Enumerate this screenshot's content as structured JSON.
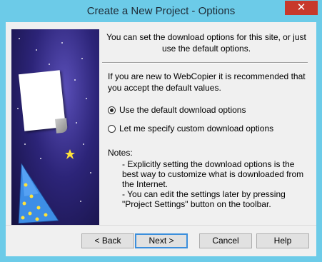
{
  "window": {
    "title": "Create a New Project - Options",
    "close_glyph": "✕"
  },
  "intro_text": "You can set the download options for this site, or just use the default options.",
  "recommend_text": "If you are new to WebCopier it is recommended that you accept the default values.",
  "options": [
    {
      "label": "Use the default download options",
      "selected": true
    },
    {
      "label": "Let me specify custom download options",
      "selected": false
    }
  ],
  "notes": {
    "label": "Notes:",
    "lines": [
      "- Explicitly setting the download options is the best way to customize what is downloaded from the Internet.",
      "- You can edit the settings later by pressing \"Project Settings\" button on the toolbar."
    ]
  },
  "buttons": {
    "back": "< Back",
    "next": "Next >",
    "cancel": "Cancel",
    "help": "Help"
  },
  "colors": {
    "titlebar": "#6ccbe8",
    "close": "#c7382b",
    "background": "#f0f0f0"
  }
}
